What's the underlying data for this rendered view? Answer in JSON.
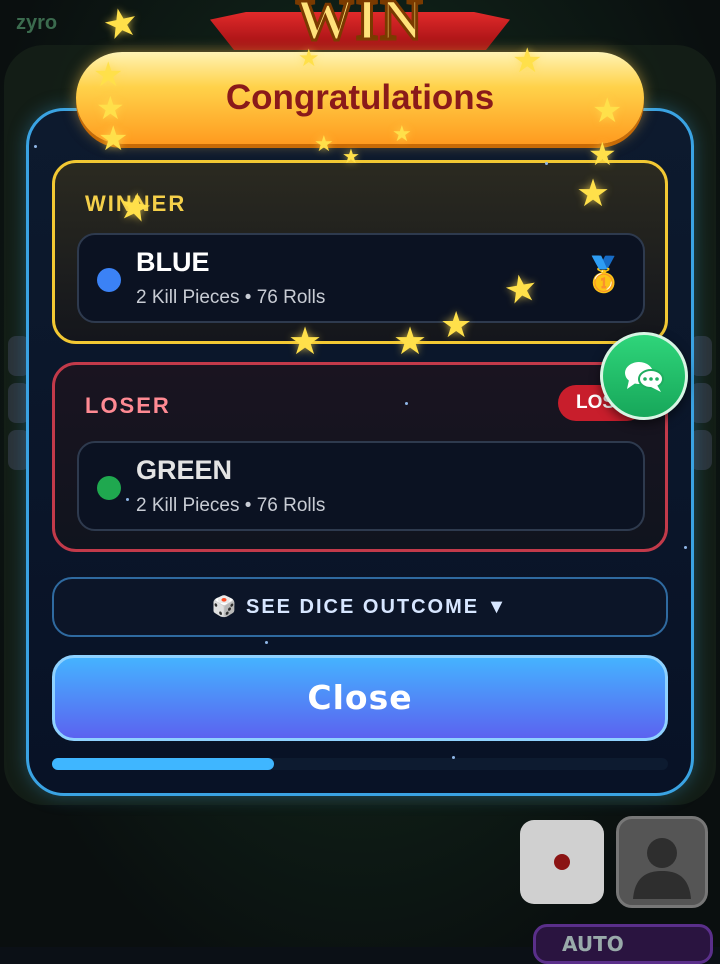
{
  "background": {
    "brand_text": "zyro",
    "player_name": "",
    "auto_label": "AUTO"
  },
  "banner": {
    "text": "WIN"
  },
  "dialog": {
    "title": "Congratulations",
    "winner": {
      "heading": "WINNER",
      "player_name": "BLUE",
      "stats": "2 Kill Pieces • 76 Rolls",
      "color": "#3b82f6",
      "icon": "medal-icon"
    },
    "loser": {
      "heading": "LOSER",
      "badge": "LOST",
      "player_name": "GREEN",
      "stats": "2 Kill Pieces • 76 Rolls",
      "color": "#1fa84f"
    },
    "dice_outcome_button": "🎲  SEE DICE OUTCOME  ▼",
    "close_button": "Close",
    "progress": 0.36
  },
  "chat_button": {
    "icon": "chat-icon"
  }
}
